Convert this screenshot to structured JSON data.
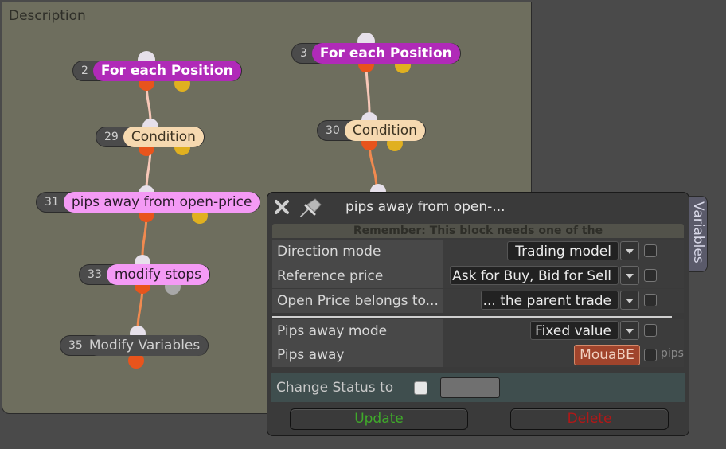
{
  "canvas": {
    "title": "Description",
    "nodes": [
      {
        "id": "2",
        "label": "For each Position",
        "style": "purple"
      },
      {
        "id": "29",
        "label": "Condition",
        "style": "cream"
      },
      {
        "id": "31",
        "label": "pips away from open-price",
        "style": "pink"
      },
      {
        "id": "33",
        "label": "modify stops",
        "style": "pink"
      },
      {
        "id": "35",
        "label": "Modify Variables",
        "style": "gray"
      },
      {
        "id": "3",
        "label": "For each Position",
        "style": "purple"
      },
      {
        "id": "30",
        "label": "Condition",
        "style": "cream"
      }
    ]
  },
  "dialog": {
    "title": "pips away from open-...",
    "note": "Remember: This block needs one of the",
    "rows": [
      {
        "label": "Direction mode",
        "value": "Trading model"
      },
      {
        "label": "Reference price",
        "value": "Ask for Buy, Bid for Sell"
      },
      {
        "label": "Open Price belongs to...",
        "value": "... the parent trade"
      },
      {
        "label": "Pips away mode",
        "value": "Fixed value"
      },
      {
        "label": "Pips away",
        "value": "MouaBE",
        "unit": "pips"
      }
    ],
    "status_label": "Change Status to",
    "update_label": "Update",
    "delete_label": "Delete"
  },
  "side_tab": {
    "label": "Variables"
  },
  "colors": {
    "canvas_bg": "#6e6e5e",
    "purple": "#b02ab8",
    "cream": "#f6d9b0",
    "pink": "#f49af5",
    "orange_dot": "#e8541c",
    "yellow_dot": "#e0b020",
    "update_text": "#3faa2a",
    "delete_text": "#b01818"
  }
}
